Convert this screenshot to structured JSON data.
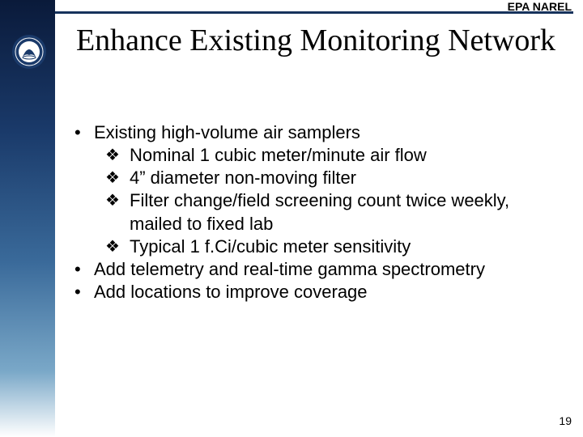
{
  "header": {
    "label": "EPA NAREL"
  },
  "title": "Enhance Existing Monitoring Network",
  "content": {
    "bullets": [
      {
        "text": "Existing high-volume air samplers",
        "subs": [
          "Nominal 1 cubic meter/minute air flow",
          "4” diameter non-moving filter",
          "Filter change/field screening count twice weekly, mailed to fixed lab",
          "Typical 1 f.Ci/cubic meter sensitivity"
        ]
      },
      {
        "text": "Add telemetry and real-time gamma spectrometry",
        "subs": []
      },
      {
        "text": "Add locations to improve coverage",
        "subs": []
      }
    ]
  },
  "page_number": "19"
}
